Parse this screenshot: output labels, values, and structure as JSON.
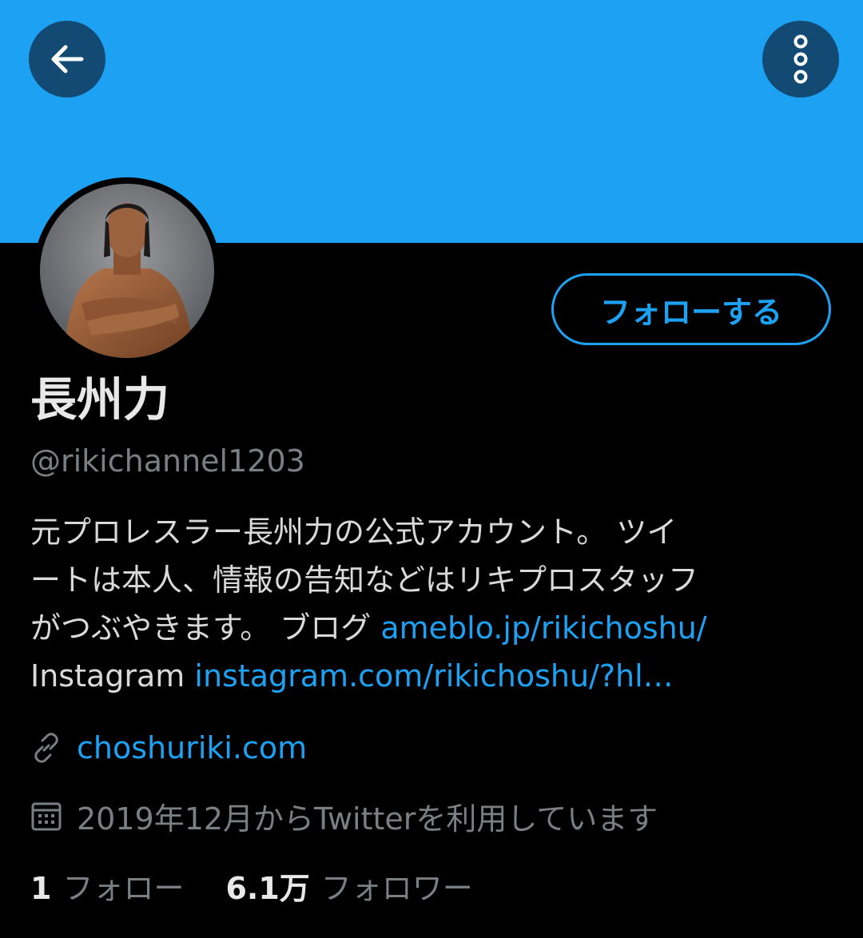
{
  "header": {
    "banner_color": "#1da1f2",
    "back_icon": "arrow-left-icon",
    "more_icon": "more-vertical-icon"
  },
  "profile": {
    "avatar_icon": "profile-photo",
    "follow_label": "フォローする",
    "display_name": "長州力",
    "handle": "@rikichannel1203",
    "bio": {
      "line1": "元プロレスラー長州力の公式アカウント。 ツイ",
      "line2": "ートは本人、情報の告知などはリキプロスタッフ",
      "line3_text": "がつぶやきます。 ブログ ",
      "line3_link": "ameblo.jp/rikichoshu/",
      "line4_text": "Instagram ",
      "line4_link": "instagram.com/rikichoshu/?hl…"
    },
    "website": "choshuriki.com",
    "joined": "2019年12月からTwitterを利用しています"
  },
  "stats": {
    "following_count": "1",
    "following_label": "フォロー",
    "followers_count": "6.1万",
    "followers_label": "フォロワー"
  },
  "colors": {
    "accent": "#1da1f2",
    "background": "#000000",
    "secondary_text": "#7a7f84"
  }
}
